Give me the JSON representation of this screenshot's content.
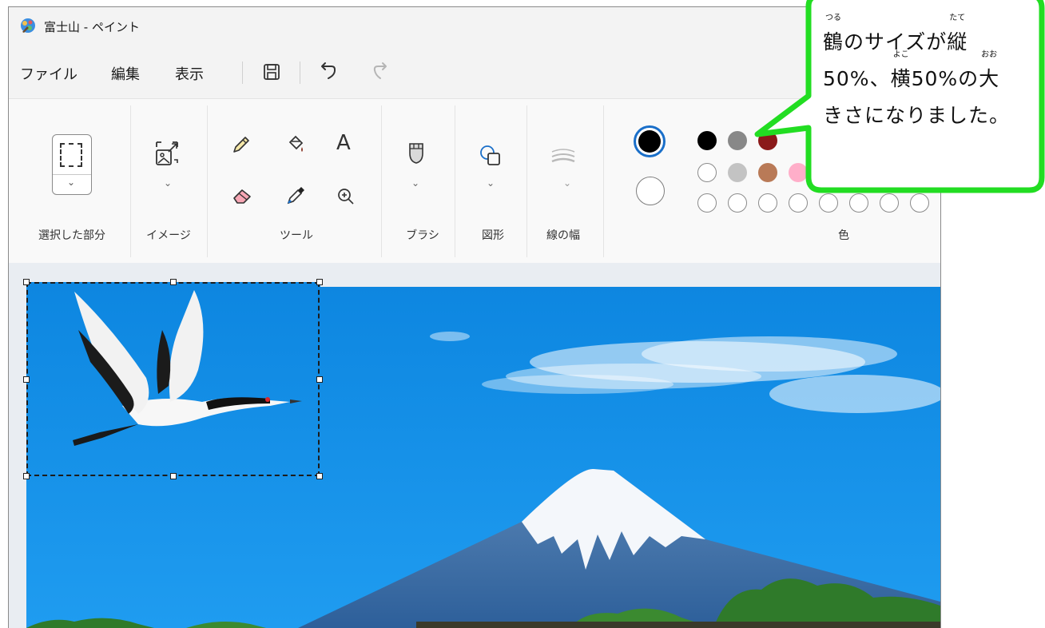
{
  "window": {
    "title": "富士山 - ペイント"
  },
  "menu": {
    "file": "ファイル",
    "edit": "編集",
    "view": "表示"
  },
  "ribbon": {
    "groups": {
      "selection": "選択した部分",
      "image": "イメージ",
      "tools": "ツール",
      "brushes": "ブラシ",
      "shapes": "図形",
      "line_width": "線の幅",
      "colors": "色"
    }
  },
  "colors": {
    "primary": "#000000",
    "secondary": "#ffffff",
    "row1": [
      "#000000",
      "#888888",
      "#8b1a1a"
    ],
    "row2": [
      "#ffffff",
      "#c3c3c3",
      "#b97a57",
      "#ffaec9"
    ],
    "row3": [
      "#ffffff",
      "#ffffff",
      "#ffffff",
      "#ffffff",
      "#ffffff",
      "#ffffff",
      "#ffffff",
      "#ffffff"
    ],
    "accent": "#1a6fc9",
    "callout_border": "#22dd22"
  },
  "callout": {
    "w1": "鶴",
    "w1_ruby": "つる",
    "t1": "のサイズが",
    "w2": "縦",
    "w2_ruby": "たて",
    "t2": "50%、",
    "w3": "横",
    "w3_ruby": "よこ",
    "t3": "50%の",
    "w4": "大",
    "w4_ruby": "おお",
    "t4": "きさになりました。"
  },
  "icons": {
    "save": "save-icon",
    "undo": "undo-icon",
    "redo": "redo-icon",
    "pencil": "pencil-icon",
    "fill": "fill-bucket-icon",
    "text": "text-icon",
    "eraser": "eraser-icon",
    "picker": "color-picker-icon",
    "magnifier": "magnifier-icon"
  },
  "ribbon_glyphs": {
    "text_tool": "A",
    "chevron": "⌄"
  }
}
